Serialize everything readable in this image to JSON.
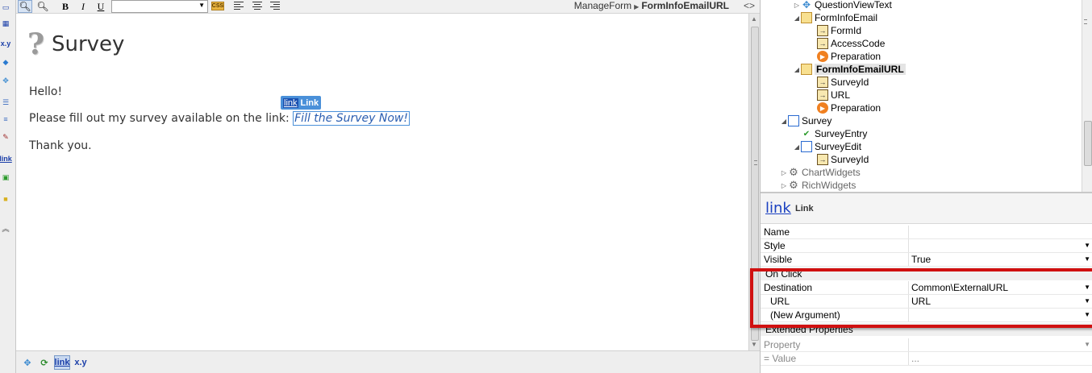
{
  "toolbar": {
    "breadcrumb": [
      "ManageForm",
      "FormInfoEmailURL"
    ],
    "code_toggle": "<>",
    "bold": "B",
    "italic": "I",
    "underline": "U",
    "css": "CSS",
    "font_select_value": ""
  },
  "left_toolbar": {
    "expression_label": "x.y",
    "link_label": "link"
  },
  "canvas": {
    "title": "Survey",
    "hello": "Hello!",
    "body_prefix": "Please fill out my survey available on the link: ",
    "link_text": "Fill the Survey Now!",
    "thanks": "Thank you.",
    "link_badge_word": "link",
    "link_badge_label": "Link"
  },
  "bottom_toolbar": {
    "link_label": "link",
    "expression_label": "x.y"
  },
  "tree": [
    {
      "label": "QuestionViewText",
      "icon": "puzzle-icon"
    },
    {
      "label": "FormInfoEmail",
      "icon": "form-icon"
    },
    {
      "label": "FormId",
      "icon": "input-parameter-icon"
    },
    {
      "label": "AccessCode",
      "icon": "input-parameter-icon"
    },
    {
      "label": "Preparation",
      "icon": "preparation-icon"
    },
    {
      "label": "FormInfoEmailURL",
      "icon": "form-icon"
    },
    {
      "label": "SurveyId",
      "icon": "input-parameter-icon"
    },
    {
      "label": "URL",
      "icon": "input-parameter-icon"
    },
    {
      "label": "Preparation",
      "icon": "preparation-icon"
    },
    {
      "label": "Survey",
      "icon": "screen-flow-icon"
    },
    {
      "label": "SurveyEntry",
      "icon": "entry-screen-icon"
    },
    {
      "label": "SurveyEdit",
      "icon": "screen-icon"
    },
    {
      "label": "SurveyId",
      "icon": "input-parameter-icon"
    },
    {
      "label": "ChartWidgets",
      "icon": "gear-icon"
    },
    {
      "label": "RichWidgets",
      "icon": "gear-icon"
    }
  ],
  "properties": {
    "header_big": "link",
    "header_small": "Link",
    "rows": [
      {
        "name": "Name",
        "value": ""
      },
      {
        "name": "Style",
        "value": ""
      },
      {
        "name": "Visible",
        "value": "True"
      }
    ],
    "on_click_label": "On Click",
    "on_click_rows": [
      {
        "name": "Destination",
        "value": "Common\\ExternalURL"
      },
      {
        "name": "URL",
        "value": "URL"
      },
      {
        "name": "(New Argument)",
        "value": ""
      }
    ],
    "extended_label": "Extended Properties",
    "extended_rows": [
      {
        "name": "Property",
        "value": ""
      },
      {
        "name": "=  Value",
        "value": "..."
      }
    ]
  },
  "colors": {
    "highlight": "#d01010",
    "link_blue": "#2a5db0"
  }
}
